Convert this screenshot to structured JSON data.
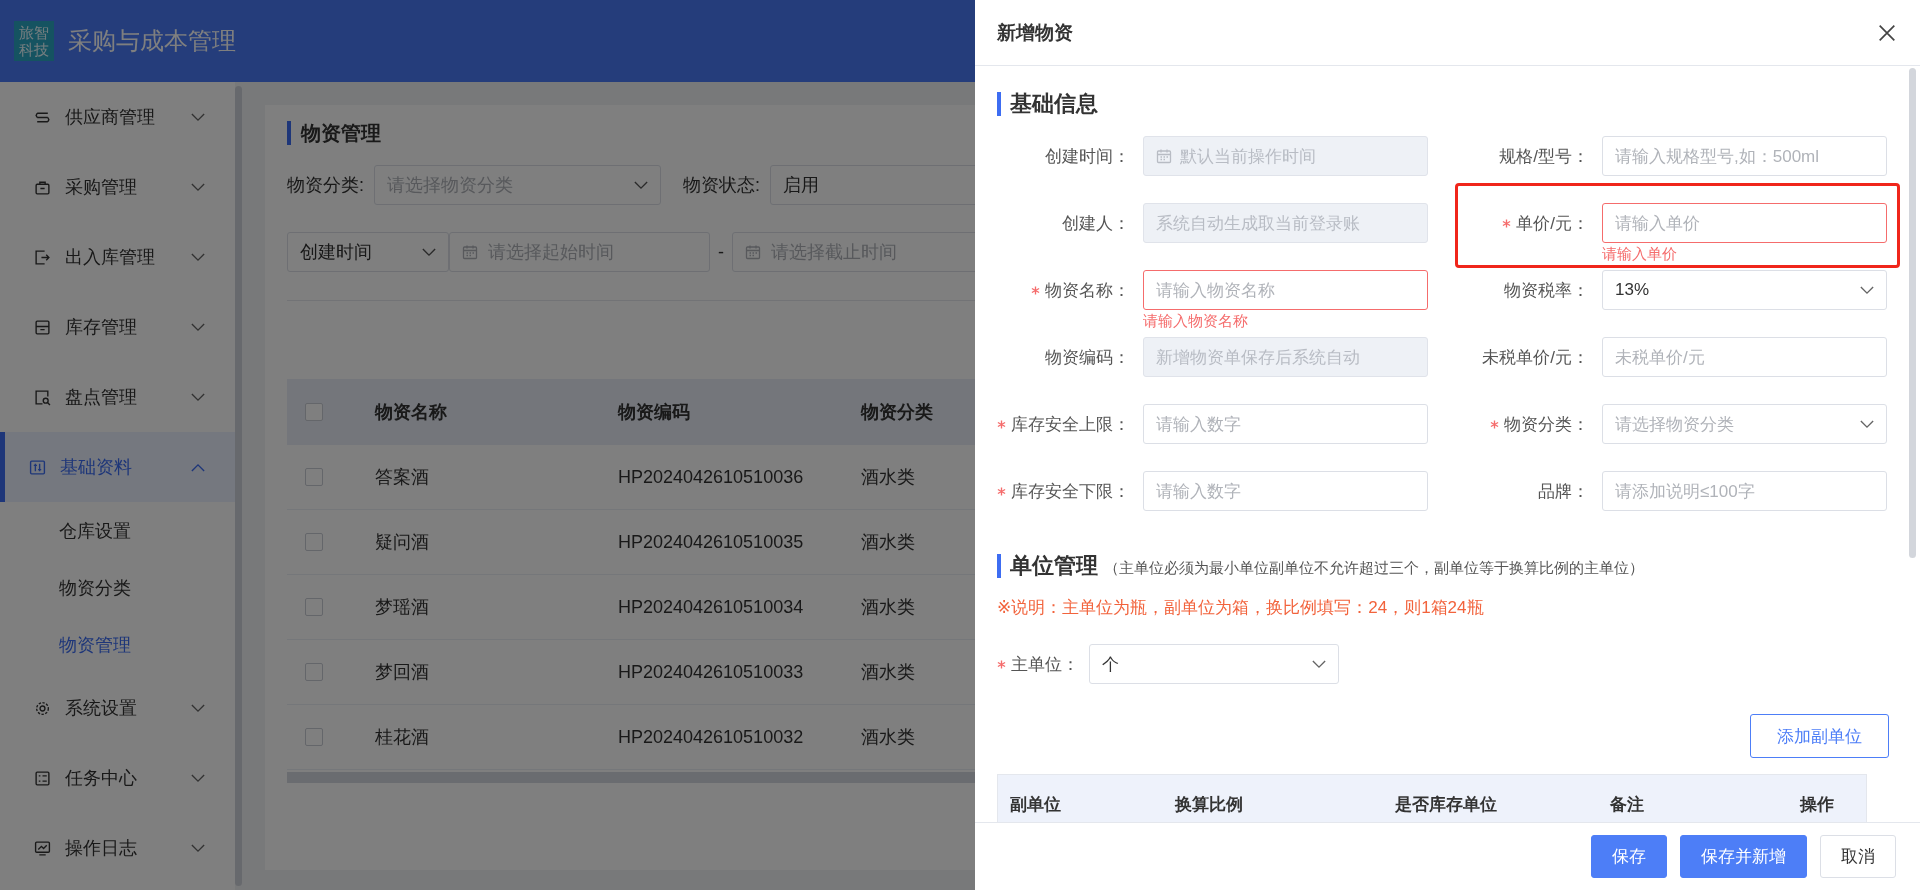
{
  "app": {
    "logo": "旅智科技",
    "title": "采购与成本管理"
  },
  "sidebar": {
    "items": [
      {
        "label": "供应商管理",
        "expanded": false,
        "selected": false
      },
      {
        "label": "采购管理",
        "expanded": false,
        "selected": false
      },
      {
        "label": "出入库管理",
        "expanded": false,
        "selected": false
      },
      {
        "label": "库存管理",
        "expanded": false,
        "selected": false
      },
      {
        "label": "盘点管理",
        "expanded": false,
        "selected": false
      },
      {
        "label": "基础资料",
        "expanded": true,
        "selected": true,
        "children": [
          {
            "label": "仓库设置",
            "selected": false
          },
          {
            "label": "物资分类",
            "selected": false
          },
          {
            "label": "物资管理",
            "selected": true
          }
        ]
      },
      {
        "label": "系统设置",
        "expanded": false,
        "selected": false
      },
      {
        "label": "任务中心",
        "expanded": false,
        "selected": false
      },
      {
        "label": "操作日志",
        "expanded": false,
        "selected": false
      }
    ]
  },
  "page": {
    "title": "物资管理",
    "filters": [
      {
        "label": "物资分类:",
        "kind": "select",
        "placeholder": "请选择物资分类"
      },
      {
        "label": "物资状态:",
        "kind": "select",
        "value": "启用"
      }
    ],
    "date_filter": {
      "field": "创建时间",
      "start_placeholder": "请选择起始时间",
      "separator": "-",
      "end_placeholder": "请选择截止时间"
    },
    "table": {
      "all_checked": false,
      "columns": [
        "物资名称",
        "物资编码",
        "物资分类"
      ],
      "rows": [
        {
          "checked": false,
          "cells": [
            "答案酒",
            "HP2024042610510036",
            "酒水类"
          ]
        },
        {
          "checked": false,
          "cells": [
            "疑问酒",
            "HP2024042610510035",
            "酒水类"
          ]
        },
        {
          "checked": false,
          "cells": [
            "梦瑶酒",
            "HP2024042610510034",
            "酒水类"
          ]
        },
        {
          "checked": false,
          "cells": [
            "梦回酒",
            "HP2024042610510033",
            "酒水类"
          ]
        },
        {
          "checked": false,
          "cells": [
            "桂花酒",
            "HP2024042610510032",
            "酒水类"
          ]
        }
      ]
    }
  },
  "drawer": {
    "title": "新增物资",
    "basic_info": {
      "title": "基础信息",
      "fields": [
        {
          "label": "创建时间：",
          "kind": "date",
          "required": false,
          "disabled": true,
          "placeholder": "默认当前操作时间"
        },
        {
          "label": "规格/型号：",
          "kind": "input",
          "required": false,
          "disabled": false,
          "placeholder": "请输入规格型号,如：500ml"
        },
        {
          "label": "创建人：",
          "kind": "input",
          "required": false,
          "disabled": true,
          "placeholder": "系统自动生成取当前登录账"
        },
        {
          "label": "单价/元：",
          "kind": "input",
          "required": true,
          "disabled": false,
          "placeholder": "请输入单价",
          "error": "请输入单价",
          "highlighted": true
        },
        {
          "label": "物资名称：",
          "kind": "input",
          "required": true,
          "disabled": false,
          "placeholder": "请输入物资名称",
          "error": "请输入物资名称"
        },
        {
          "label": "物资税率：",
          "kind": "select",
          "required": false,
          "disabled": false,
          "value": "13%"
        },
        {
          "label": "物资编码：",
          "kind": "input",
          "required": false,
          "disabled": true,
          "placeholder": "新增物资单保存后系统自动"
        },
        {
          "label": "未税单价/元：",
          "kind": "input",
          "required": false,
          "disabled": false,
          "placeholder": "未税单价/元"
        },
        {
          "label": "库存安全上限：",
          "kind": "input",
          "required": true,
          "disabled": false,
          "placeholder": "请输入数字"
        },
        {
          "label": "物资分类：",
          "kind": "select",
          "required": true,
          "disabled": false,
          "placeholder": "请选择物资分类"
        },
        {
          "label": "库存安全下限：",
          "kind": "input",
          "required": true,
          "disabled": false,
          "placeholder": "请输入数字"
        },
        {
          "label": "品牌：",
          "kind": "input",
          "required": false,
          "disabled": false,
          "placeholder": "请添加说明≤100字"
        }
      ]
    },
    "units": {
      "title": "单位管理",
      "hint": "（主单位必须为最小单位副单位不允许超过三个，副单位等于换算比例的主单位）",
      "note": "※说明：主单位为瓶，副单位为箱，换比例填写：24，则1箱24瓶",
      "main_unit": {
        "label": "主单位：",
        "required": true,
        "value": "个"
      },
      "add_button": "添加副单位",
      "table_columns": [
        "副单位",
        "换算比例",
        "是否库存单位",
        "备注",
        "操作"
      ]
    },
    "footer_buttons": [
      {
        "label": "保存",
        "kind": "primary"
      },
      {
        "label": "保存并新增",
        "kind": "primary"
      },
      {
        "label": "取消",
        "kind": "default"
      }
    ]
  }
}
